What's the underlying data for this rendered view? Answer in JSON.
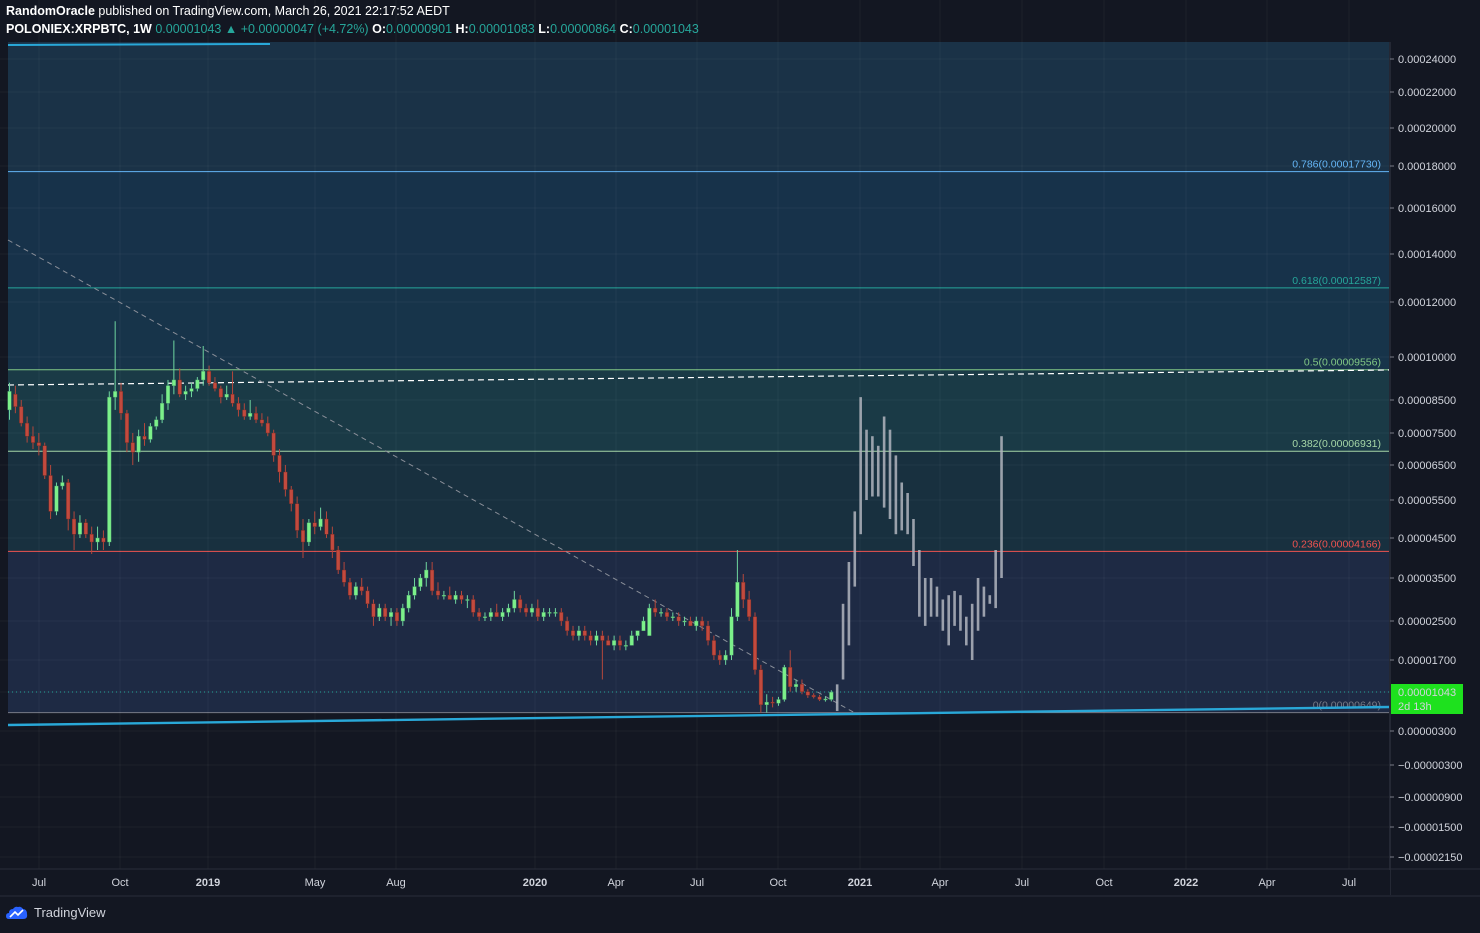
{
  "header": {
    "author": "RandomOracle",
    "published_text": "published on TradingView.com, March 26, 2021 22:17:52 AEDT",
    "symbol": "POLONIEX:XRPBTC, 1W",
    "last_price": "0.00001043",
    "change": "+0.00000047 (+4.72%)",
    "open_label": "O:",
    "open": "0.00000901",
    "high_label": "H:",
    "high": "0.00001083",
    "low_label": "L:",
    "low": "0.00000864",
    "close_label": "C:",
    "close": "0.00001043"
  },
  "footer": {
    "brand": "TradingView"
  },
  "colors": {
    "background": "#131722",
    "up": "#7cf08a",
    "down": "#c24a3e",
    "projection": "#b2b5be",
    "trendline": "#29a8d8",
    "price_tag": "#1ee11e"
  },
  "chart_data": {
    "type": "candlestick",
    "timeframe": "1W",
    "y_axis": {
      "tick_labels": [
        "0.00024000",
        "0.00022000",
        "0.00020000",
        "0.00018000",
        "0.00016000",
        "0.00014000",
        "0.00012000",
        "0.00010000",
        "0.00008500",
        "0.00007500",
        "0.00006500",
        "0.00005500",
        "0.00004500",
        "0.00003500",
        "0.00002500",
        "0.00001700",
        "0.00001043",
        "0.00000300",
        "−0.00000300",
        "−0.00000900",
        "−0.00001500",
        "−0.00002150"
      ],
      "tick_values": [
        0.00024,
        0.00022,
        0.0002,
        0.00018,
        0.00016,
        0.00014,
        0.00012,
        0.0001,
        8.5e-05,
        7.5e-05,
        6.5e-05,
        5.5e-05,
        4.5e-05,
        3.5e-05,
        2.5e-05,
        1.7e-05,
        1.043e-05,
        3e-06,
        -3e-06,
        -9e-06,
        -1.5e-05,
        -2.15e-05
      ]
    },
    "x_axis": {
      "tick_labels": [
        "Jul",
        "Oct",
        "2019",
        "May",
        "Aug",
        "2020",
        "Apr",
        "Jul",
        "Oct",
        "2021",
        "Apr",
        "Jul",
        "Oct",
        "2022",
        "Apr",
        "Jul"
      ],
      "bold": [
        false,
        false,
        true,
        false,
        false,
        true,
        false,
        false,
        false,
        true,
        false,
        false,
        false,
        true,
        false,
        false
      ]
    },
    "fib_levels": [
      {
        "label": "0.786(0.00017730)",
        "value": 0.0001773,
        "color": "#64b5f6"
      },
      {
        "label": "0.618(0.00012587)",
        "value": 0.00012587,
        "color": "#26a69a"
      },
      {
        "label": "0.5(0.00009556)",
        "value": 9.556e-05,
        "color": "#81c784"
      },
      {
        "label": "0.382(0.00006931)",
        "value": 6.931e-05,
        "color": "#a5d6a7"
      },
      {
        "label": "0.236(0.00004166)",
        "value": 4.166e-05,
        "color": "#ef5350"
      },
      {
        "label": "0(0.00000649)",
        "value": 6.49e-06,
        "color": "#787b86"
      }
    ],
    "price_tag": {
      "value": "0.00001043",
      "countdown": "2d 13h"
    },
    "candles": [
      {
        "o": 8.2e-05,
        "h": 9.1e-05,
        "l": 7.9e-05,
        "c": 8.8e-05
      },
      {
        "o": 8.7e-05,
        "h": 9e-05,
        "l": 8.1e-05,
        "c": 8.3e-05
      },
      {
        "o": 8.3e-05,
        "h": 8.5e-05,
        "l": 7.7e-05,
        "c": 7.8e-05
      },
      {
        "o": 7.8e-05,
        "h": 8e-05,
        "l": 7.2e-05,
        "c": 7.4e-05
      },
      {
        "o": 7.4e-05,
        "h": 7.7e-05,
        "l": 7e-05,
        "c": 7.2e-05
      },
      {
        "o": 7.2e-05,
        "h": 7.5e-05,
        "l": 6.8e-05,
        "c": 7.1e-05
      },
      {
        "o": 7.1e-05,
        "h": 7.2e-05,
        "l": 6.1e-05,
        "c": 6.2e-05
      },
      {
        "o": 6.2e-05,
        "h": 6.5e-05,
        "l": 5e-05,
        "c": 5.2e-05
      },
      {
        "o": 5.2e-05,
        "h": 6e-05,
        "l": 5.1e-05,
        "c": 5.9e-05
      },
      {
        "o": 5.9e-05,
        "h": 6.2e-05,
        "l": 5.8e-05,
        "c": 6e-05
      },
      {
        "o": 6e-05,
        "h": 6.1e-05,
        "l": 4.7e-05,
        "c": 5e-05
      },
      {
        "o": 5e-05,
        "h": 5.2e-05,
        "l": 4.2e-05,
        "c": 4.6e-05
      },
      {
        "o": 4.6e-05,
        "h": 5.1e-05,
        "l": 4.5e-05,
        "c": 4.9e-05
      },
      {
        "o": 4.9e-05,
        "h": 5e-05,
        "l": 4.5e-05,
        "c": 4.6e-05
      },
      {
        "o": 4.6e-05,
        "h": 4.8e-05,
        "l": 4.1e-05,
        "c": 4.4e-05
      },
      {
        "o": 4.4e-05,
        "h": 4.8e-05,
        "l": 4.2e-05,
        "c": 4.5e-05
      },
      {
        "o": 4.5e-05,
        "h": 4.7e-05,
        "l": 4.2e-05,
        "c": 4.4e-05
      },
      {
        "o": 4.4e-05,
        "h": 8.8e-05,
        "l": 4.3e-05,
        "c": 8.6e-05
      },
      {
        "o": 8.6e-05,
        "h": 0.000113,
        "l": 8.2e-05,
        "c": 8.8e-05
      },
      {
        "o": 8.8e-05,
        "h": 9.1e-05,
        "l": 7.9e-05,
        "c": 8.1e-05
      },
      {
        "o": 8.1e-05,
        "h": 8.2e-05,
        "l": 6.9e-05,
        "c": 7.2e-05
      },
      {
        "o": 7.2e-05,
        "h": 7.5e-05,
        "l": 6.5e-05,
        "c": 6.9e-05
      },
      {
        "o": 6.9e-05,
        "h": 7.6e-05,
        "l": 6.6e-05,
        "c": 7.4e-05
      },
      {
        "o": 7.4e-05,
        "h": 7.8e-05,
        "l": 7.1e-05,
        "c": 7.3e-05
      },
      {
        "o": 7.3e-05,
        "h": 7.8e-05,
        "l": 7.2e-05,
        "c": 7.7e-05
      },
      {
        "o": 7.7e-05,
        "h": 8e-05,
        "l": 7.6e-05,
        "c": 7.9e-05
      },
      {
        "o": 7.9e-05,
        "h": 8.7e-05,
        "l": 7.8e-05,
        "c": 8.4e-05
      },
      {
        "o": 8.4e-05,
        "h": 9.2e-05,
        "l": 8.2e-05,
        "c": 9e-05
      },
      {
        "o": 9e-05,
        "h": 0.000106,
        "l": 8.7e-05,
        "c": 9.2e-05
      },
      {
        "o": 9.2e-05,
        "h": 9.6e-05,
        "l": 8.6e-05,
        "c": 8.7e-05
      },
      {
        "o": 8.7e-05,
        "h": 9e-05,
        "l": 8.5e-05,
        "c": 8.8e-05
      },
      {
        "o": 8.8e-05,
        "h": 9.1e-05,
        "l": 8.6e-05,
        "c": 8.9e-05
      },
      {
        "o": 8.9e-05,
        "h": 9.3e-05,
        "l": 8.8e-05,
        "c": 9.2e-05
      },
      {
        "o": 9.2e-05,
        "h": 0.000104,
        "l": 9e-05,
        "c": 9.5e-05
      },
      {
        "o": 9.5e-05,
        "h": 9.7e-05,
        "l": 9e-05,
        "c": 9.1e-05
      },
      {
        "o": 9.1e-05,
        "h": 9.3e-05,
        "l": 8.8e-05,
        "c": 8.9e-05
      },
      {
        "o": 8.9e-05,
        "h": 9e-05,
        "l": 8.4e-05,
        "c": 8.6e-05
      },
      {
        "o": 8.6e-05,
        "h": 9e-05,
        "l": 8.5e-05,
        "c": 8.7e-05
      },
      {
        "o": 8.7e-05,
        "h": 9.5e-05,
        "l": 8.3e-05,
        "c": 8.4e-05
      },
      {
        "o": 8.4e-05,
        "h": 8.6e-05,
        "l": 8e-05,
        "c": 8.2e-05
      },
      {
        "o": 8.2e-05,
        "h": 8.4e-05,
        "l": 7.9e-05,
        "c": 8e-05
      },
      {
        "o": 8e-05,
        "h": 8.5e-05,
        "l": 7.9e-05,
        "c": 8.1e-05
      },
      {
        "o": 8.1e-05,
        "h": 8.3e-05,
        "l": 7.8e-05,
        "c": 7.9e-05
      },
      {
        "o": 7.9e-05,
        "h": 8.1e-05,
        "l": 7.7e-05,
        "c": 7.8e-05
      },
      {
        "o": 7.8e-05,
        "h": 8e-05,
        "l": 7.4e-05,
        "c": 7.5e-05
      },
      {
        "o": 7.5e-05,
        "h": 7.6e-05,
        "l": 6.6e-05,
        "c": 6.8e-05
      },
      {
        "o": 6.8e-05,
        "h": 7e-05,
        "l": 6e-05,
        "c": 6.3e-05
      },
      {
        "o": 6.3e-05,
        "h": 6.5e-05,
        "l": 5.6e-05,
        "c": 5.8e-05
      },
      {
        "o": 5.8e-05,
        "h": 5.9e-05,
        "l": 5.2e-05,
        "c": 5.4e-05
      },
      {
        "o": 5.4e-05,
        "h": 5.6e-05,
        "l": 4.5e-05,
        "c": 4.7e-05
      },
      {
        "o": 4.7e-05,
        "h": 5e-05,
        "l": 4e-05,
        "c": 4.4e-05
      },
      {
        "o": 4.4e-05,
        "h": 5e-05,
        "l": 4.3e-05,
        "c": 4.9e-05
      },
      {
        "o": 4.9e-05,
        "h": 5.2e-05,
        "l": 4.6e-05,
        "c": 4.8e-05
      },
      {
        "o": 4.8e-05,
        "h": 5.3e-05,
        "l": 4.7e-05,
        "c": 5e-05
      },
      {
        "o": 5e-05,
        "h": 5.2e-05,
        "l": 4.5e-05,
        "c": 4.6e-05
      },
      {
        "o": 4.6e-05,
        "h": 4.8e-05,
        "l": 4e-05,
        "c": 4.2e-05
      },
      {
        "o": 4.2e-05,
        "h": 4.3e-05,
        "l": 3.6e-05,
        "c": 3.7e-05
      },
      {
        "o": 3.7e-05,
        "h": 3.9e-05,
        "l": 3.3e-05,
        "c": 3.4e-05
      },
      {
        "o": 3.4e-05,
        "h": 3.5e-05,
        "l": 3e-05,
        "c": 3.1e-05
      },
      {
        "o": 3.1e-05,
        "h": 3.4e-05,
        "l": 3e-05,
        "c": 3.3e-05
      },
      {
        "o": 3.3e-05,
        "h": 3.5e-05,
        "l": 3.1e-05,
        "c": 3.2e-05
      },
      {
        "o": 3.2e-05,
        "h": 3.3e-05,
        "l": 2.8e-05,
        "c": 2.9e-05
      },
      {
        "o": 2.9e-05,
        "h": 3e-05,
        "l": 2.4e-05,
        "c": 2.6e-05
      },
      {
        "o": 2.6e-05,
        "h": 2.9e-05,
        "l": 2.5e-05,
        "c": 2.8e-05
      },
      {
        "o": 2.8e-05,
        "h": 2.9e-05,
        "l": 2.5e-05,
        "c": 2.6e-05
      },
      {
        "o": 2.6e-05,
        "h": 2.8e-05,
        "l": 2.4e-05,
        "c": 2.7e-05
      },
      {
        "o": 2.7e-05,
        "h": 2.8e-05,
        "l": 2.4e-05,
        "c": 2.5e-05
      },
      {
        "o": 2.5e-05,
        "h": 2.9e-05,
        "l": 2.4e-05,
        "c": 2.8e-05
      },
      {
        "o": 2.8e-05,
        "h": 3.2e-05,
        "l": 2.7e-05,
        "c": 3.1e-05
      },
      {
        "o": 3.1e-05,
        "h": 3.5e-05,
        "l": 3e-05,
        "c": 3.3e-05
      },
      {
        "o": 3.3e-05,
        "h": 3.6e-05,
        "l": 3.2e-05,
        "c": 3.5e-05
      },
      {
        "o": 3.5e-05,
        "h": 3.9e-05,
        "l": 3.3e-05,
        "c": 3.7e-05
      },
      {
        "o": 3.7e-05,
        "h": 3.9e-05,
        "l": 3.1e-05,
        "c": 3.2e-05
      },
      {
        "o": 3.2e-05,
        "h": 3.4e-05,
        "l": 3e-05,
        "c": 3.1e-05
      },
      {
        "o": 3.1e-05,
        "h": 3.2e-05,
        "l": 3e-05,
        "c": 3.1e-05
      },
      {
        "o": 3.1e-05,
        "h": 3.3e-05,
        "l": 3e-05,
        "c": 3e-05
      },
      {
        "o": 3e-05,
        "h": 3.2e-05,
        "l": 2.9e-05,
        "c": 3.1e-05
      },
      {
        "o": 3.1e-05,
        "h": 3.2e-05,
        "l": 2.9e-05,
        "c": 3e-05
      },
      {
        "o": 3e-05,
        "h": 3.1e-05,
        "l": 2.8e-05,
        "c": 3e-05
      },
      {
        "o": 3e-05,
        "h": 3.1e-05,
        "l": 2.6e-05,
        "c": 2.7e-05
      },
      {
        "o": 2.7e-05,
        "h": 2.8e-05,
        "l": 2.5e-05,
        "c": 2.6e-05
      },
      {
        "o": 2.6e-05,
        "h": 2.7e-05,
        "l": 2.5e-05,
        "c": 2.6e-05
      },
      {
        "o": 2.6e-05,
        "h": 2.8e-05,
        "l": 2.5e-05,
        "c": 2.7e-05
      },
      {
        "o": 2.7e-05,
        "h": 2.9e-05,
        "l": 2.6e-05,
        "c": 2.6e-05
      },
      {
        "o": 2.6e-05,
        "h": 2.8e-05,
        "l": 2.5e-05,
        "c": 2.7e-05
      },
      {
        "o": 2.7e-05,
        "h": 2.9e-05,
        "l": 2.6e-05,
        "c": 2.8e-05
      },
      {
        "o": 2.8e-05,
        "h": 3.2e-05,
        "l": 2.7e-05,
        "c": 3e-05
      },
      {
        "o": 3e-05,
        "h": 3.1e-05,
        "l": 2.7e-05,
        "c": 2.8e-05
      },
      {
        "o": 2.8e-05,
        "h": 2.9e-05,
        "l": 2.6e-05,
        "c": 2.7e-05
      },
      {
        "o": 2.7e-05,
        "h": 2.9e-05,
        "l": 2.6e-05,
        "c": 2.8e-05
      },
      {
        "o": 2.8e-05,
        "h": 3e-05,
        "l": 2.5e-05,
        "c": 2.6e-05
      },
      {
        "o": 2.6e-05,
        "h": 2.8e-05,
        "l": 2.5e-05,
        "c": 2.7e-05
      },
      {
        "o": 2.7e-05,
        "h": 2.8e-05,
        "l": 2.6e-05,
        "c": 2.7e-05
      },
      {
        "o": 2.7e-05,
        "h": 2.8e-05,
        "l": 2.6e-05,
        "c": 2.7e-05
      },
      {
        "o": 2.7e-05,
        "h": 2.8e-05,
        "l": 2.4e-05,
        "c": 2.5e-05
      },
      {
        "o": 2.5e-05,
        "h": 2.6e-05,
        "l": 2.2e-05,
        "c": 2.3e-05
      },
      {
        "o": 2.3e-05,
        "h": 2.4e-05,
        "l": 2.1e-05,
        "c": 2.2e-05
      },
      {
        "o": 2.2e-05,
        "h": 2.4e-05,
        "l": 2.1e-05,
        "c": 2.3e-05
      },
      {
        "o": 2.3e-05,
        "h": 2.4e-05,
        "l": 2.1e-05,
        "c": 2.2e-05
      },
      {
        "o": 2.2e-05,
        "h": 2.3e-05,
        "l": 2e-05,
        "c": 2.1e-05
      },
      {
        "o": 2.1e-05,
        "h": 2.3e-05,
        "l": 2e-05,
        "c": 2.2e-05
      },
      {
        "o": 2.2e-05,
        "h": 2.3e-05,
        "l": 1.3e-05,
        "c": 2.1e-05
      },
      {
        "o": 2.1e-05,
        "h": 2.2e-05,
        "l": 2e-05,
        "c": 2e-05
      },
      {
        "o": 2e-05,
        "h": 2.2e-05,
        "l": 1.9e-05,
        "c": 2.1e-05
      },
      {
        "o": 2.1e-05,
        "h": 2.2e-05,
        "l": 1.9e-05,
        "c": 2e-05
      },
      {
        "o": 2e-05,
        "h": 2.1e-05,
        "l": 1.9e-05,
        "c": 2e-05
      },
      {
        "o": 2e-05,
        "h": 2.3e-05,
        "l": 2e-05,
        "c": 2.2e-05
      },
      {
        "o": 2.2e-05,
        "h": 2.3e-05,
        "l": 2.1e-05,
        "c": 2.3e-05
      },
      {
        "o": 2.3e-05,
        "h": 2.6e-05,
        "l": 2.3e-05,
        "c": 2.5e-05
      },
      {
        "o": 2.2e-05,
        "h": 2.9e-05,
        "l": 2.2e-05,
        "c": 2.8e-05
      },
      {
        "o": 2.8e-05,
        "h": 3e-05,
        "l": 2.6e-05,
        "c": 2.7e-05
      },
      {
        "o": 2.7e-05,
        "h": 2.8e-05,
        "l": 2.6e-05,
        "c": 2.7e-05
      },
      {
        "o": 2.7e-05,
        "h": 2.8e-05,
        "l": 2.5e-05,
        "c": 2.6e-05
      },
      {
        "o": 2.6e-05,
        "h": 2.7e-05,
        "l": 2.5e-05,
        "c": 2.6e-05
      },
      {
        "o": 2.6e-05,
        "h": 2.7e-05,
        "l": 2.4e-05,
        "c": 2.5e-05
      },
      {
        "o": 2.5e-05,
        "h": 2.6e-05,
        "l": 2.4e-05,
        "c": 2.5e-05
      },
      {
        "o": 2.5e-05,
        "h": 2.6e-05,
        "l": 2.4e-05,
        "c": 2.4e-05
      },
      {
        "o": 2.4e-05,
        "h": 2.6e-05,
        "l": 2.3e-05,
        "c": 2.5e-05
      },
      {
        "o": 2.5e-05,
        "h": 2.6e-05,
        "l": 2.3e-05,
        "c": 2.4e-05
      },
      {
        "o": 2.4e-05,
        "h": 2.5e-05,
        "l": 2e-05,
        "c": 2.1e-05
      },
      {
        "o": 2.1e-05,
        "h": 2.2e-05,
        "l": 1.7e-05,
        "c": 1.8e-05
      },
      {
        "o": 1.8e-05,
        "h": 1.9e-05,
        "l": 1.6e-05,
        "c": 1.7e-05
      },
      {
        "o": 1.7e-05,
        "h": 1.9e-05,
        "l": 1.6e-05,
        "c": 1.8e-05
      },
      {
        "o": 1.8e-05,
        "h": 2.8e-05,
        "l": 1.7e-05,
        "c": 2.6e-05
      },
      {
        "o": 2.6e-05,
        "h": 4.2e-05,
        "l": 2.5e-05,
        "c": 3.4e-05
      },
      {
        "o": 3.4e-05,
        "h": 3.6e-05,
        "l": 2.8e-05,
        "c": 3e-05
      },
      {
        "o": 3e-05,
        "h": 3.2e-05,
        "l": 2.5e-05,
        "c": 2.6e-05
      },
      {
        "o": 2.6e-05,
        "h": 2.7e-05,
        "l": 1.4e-05,
        "c": 1.5e-05
      },
      {
        "o": 1.5e-05,
        "h": 1.6e-05,
        "l": 6.5e-06,
        "c": 8e-06
      },
      {
        "o": 8e-06,
        "h": 1e-05,
        "l": 6.5e-06,
        "c": 8.5e-06
      },
      {
        "o": 8.5e-06,
        "h": 9.5e-06,
        "l": 7.5e-06,
        "c": 8.3e-06
      },
      {
        "o": 8.3e-06,
        "h": 9.5e-06,
        "l": 7.8e-06,
        "c": 9e-06
      },
      {
        "o": 9e-06,
        "h": 1.6e-05,
        "l": 8.6e-06,
        "c": 1.55e-05
      },
      {
        "o": 1.55e-05,
        "h": 1.9e-05,
        "l": 1.05e-05,
        "c": 1.15e-05
      },
      {
        "o": 1.15e-05,
        "h": 1.3e-05,
        "l": 1.05e-05,
        "c": 1.2e-05
      },
      {
        "o": 1.2e-05,
        "h": 1.3e-05,
        "l": 1e-05,
        "c": 1.05e-05
      },
      {
        "o": 1.05e-05,
        "h": 1.1e-05,
        "l": 9.3e-06,
        "c": 9.8e-06
      },
      {
        "o": 9.8e-06,
        "h": 1.02e-05,
        "l": 9.2e-06,
        "c": 9.5e-06
      },
      {
        "o": 9.5e-06,
        "h": 9.9e-06,
        "l": 8.7e-06,
        "c": 9e-06
      },
      {
        "o": 9e-06,
        "h": 9.6e-06,
        "l": 8.6e-06,
        "c": 9.1e-06
      },
      {
        "o": 9e-06,
        "h": 1.08e-05,
        "l": 8.64e-06,
        "c": 1.04e-05
      }
    ],
    "projection_bars": [
      {
        "h": 1.2e-05,
        "l": 6.8e-06
      },
      {
        "h": 2.9e-05,
        "l": 1.3e-05
      },
      {
        "h": 3.9e-05,
        "l": 2e-05
      },
      {
        "h": 5.2e-05,
        "l": 3.3e-05
      },
      {
        "h": 8.6e-05,
        "l": 4.6e-05
      },
      {
        "h": 7.6e-05,
        "l": 5.5e-05
      },
      {
        "h": 7.4e-05,
        "l": 5.6e-05
      },
      {
        "h": 7.1e-05,
        "l": 5.6e-05
      },
      {
        "h": 8e-05,
        "l": 5.3e-05
      },
      {
        "h": 7.6e-05,
        "l": 5e-05
      },
      {
        "h": 6.8e-05,
        "l": 4.6e-05
      },
      {
        "h": 6e-05,
        "l": 4.7e-05
      },
      {
        "h": 5.7e-05,
        "l": 4.6e-05
      },
      {
        "h": 5e-05,
        "l": 3.8e-05
      },
      {
        "h": 4.2e-05,
        "l": 2.6e-05
      },
      {
        "h": 3.5e-05,
        "l": 2.4e-05
      },
      {
        "h": 3.5e-05,
        "l": 2.6e-05
      },
      {
        "h": 3.3e-05,
        "l": 2.6e-05
      },
      {
        "h": 3e-05,
        "l": 2.3e-05
      },
      {
        "h": 3.1e-05,
        "l": 2e-05
      },
      {
        "h": 3.2e-05,
        "l": 2.4e-05
      },
      {
        "h": 3.1e-05,
        "l": 2.3e-05
      },
      {
        "h": 2.6e-05,
        "l": 2e-05
      },
      {
        "h": 2.9e-05,
        "l": 1.7e-05
      },
      {
        "h": 3.5e-05,
        "l": 2.3e-05
      },
      {
        "h": 3.3e-05,
        "l": 2.6e-05
      },
      {
        "h": 3.1e-05,
        "l": 2.9e-05
      },
      {
        "h": 4.2e-05,
        "l": 2.8e-05
      },
      {
        "h": 7.4e-05,
        "l": 3.5e-05
      }
    ]
  }
}
